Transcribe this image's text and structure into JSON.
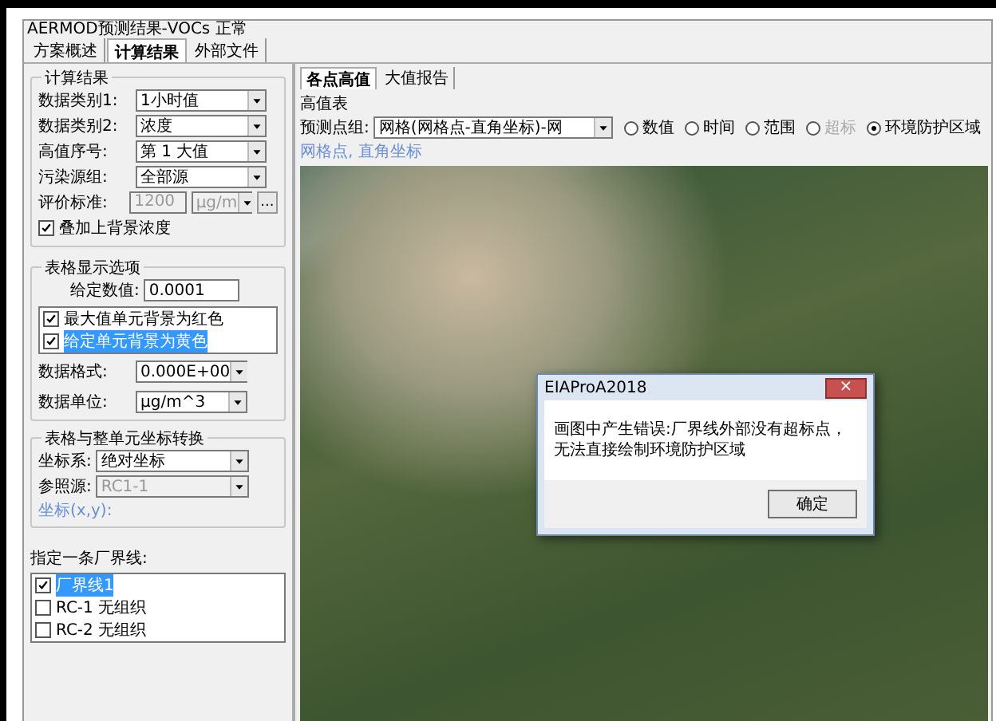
{
  "window": {
    "title": "AERMOD预测结果-VOCs 正常"
  },
  "tabs": [
    {
      "label": "方案概述",
      "selected": false
    },
    {
      "label": "计算结果",
      "selected": true
    },
    {
      "label": "外部文件",
      "selected": false
    }
  ],
  "left_panel": {
    "calc_group": {
      "title": "计算结果",
      "fields": [
        {
          "label": "数据类别1:",
          "value": "1小时值",
          "disabled": false
        },
        {
          "label": "数据类别2:",
          "value": "浓度",
          "disabled": false
        },
        {
          "label": "高值序号:",
          "value": "第 1 大值",
          "disabled": false
        },
        {
          "label": "污染源组:",
          "value": "全部源",
          "disabled": false
        }
      ],
      "standard": {
        "label": "评价标准:",
        "value": "1200",
        "unit": "μg/m",
        "disabled": true,
        "button": "..."
      },
      "overlay": {
        "label": "叠加上背景浓度",
        "checked": true
      }
    },
    "display_group": {
      "title": "表格显示选项",
      "given": {
        "label": "给定数值:",
        "value": "0.0001"
      },
      "options": [
        {
          "label": "最大值单元背景为红色",
          "checked": true,
          "selected": false
        },
        {
          "label": "给定单元背景为黄色",
          "checked": true,
          "selected": true
        }
      ],
      "format": {
        "label": "数据格式:",
        "value": "0.000E+00"
      },
      "unit": {
        "label": "数据单位:",
        "value": "μg/m^3"
      }
    },
    "coord_group": {
      "title": "表格与整单元坐标转换",
      "fields": [
        {
          "label": "坐标系:",
          "value": "绝对坐标",
          "disabled": false
        },
        {
          "label": "参照源:",
          "value": "RC1-1",
          "disabled": true
        }
      ],
      "link": "坐标(x,y):"
    },
    "boundary": {
      "label": "指定一条厂界线:",
      "items": [
        {
          "label": "厂界线1",
          "checked": true,
          "selected": true
        },
        {
          "label": "RC-1 无组织",
          "checked": false,
          "selected": false
        },
        {
          "label": "RC-2 无组织",
          "checked": false,
          "selected": false
        }
      ]
    }
  },
  "main": {
    "subtabs": [
      {
        "label": "各点高值",
        "selected": true
      },
      {
        "label": "大值报告",
        "selected": false
      }
    ],
    "group_title": "高值表",
    "point_group": {
      "label": "预测点组:",
      "value": "网格(网格点-直角坐标)-网"
    },
    "radios": [
      {
        "label": "数值",
        "selected": false,
        "disabled": false
      },
      {
        "label": "时间",
        "selected": false,
        "disabled": false
      },
      {
        "label": "范围",
        "selected": false,
        "disabled": false
      },
      {
        "label": "超标",
        "selected": false,
        "disabled": true
      },
      {
        "label": "环境防护区域",
        "selected": true,
        "disabled": false
      }
    ],
    "link": "网格点, 直角坐标"
  },
  "dialog": {
    "title": "EIAProA2018",
    "close": "×",
    "message": "画图中产生错误:厂界线外部没有超标点，无法直接绘制环境防护区域",
    "button": "确定"
  }
}
